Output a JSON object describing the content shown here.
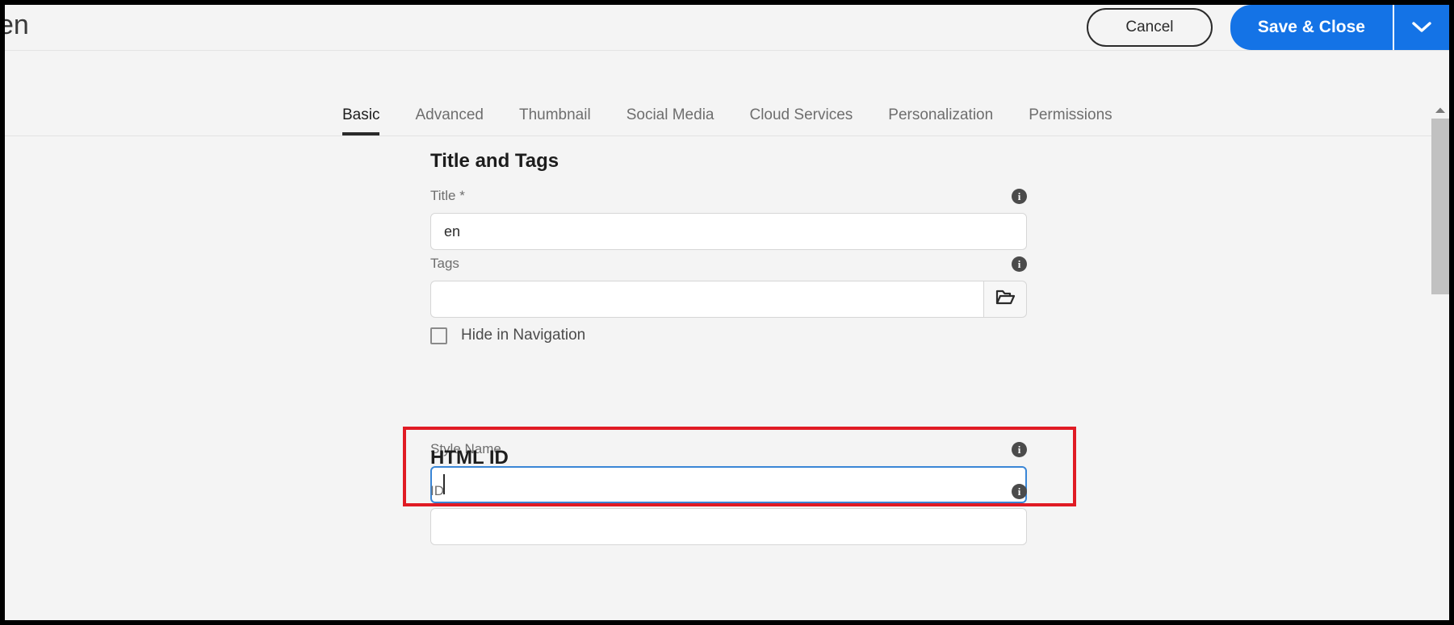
{
  "header": {
    "page_title": "en",
    "cancel_label": "Cancel",
    "save_label": "Save & Close",
    "save_caret_icon": "chevron-down-icon"
  },
  "tabs": [
    {
      "label": "Basic",
      "active": true
    },
    {
      "label": "Advanced",
      "active": false
    },
    {
      "label": "Thumbnail",
      "active": false
    },
    {
      "label": "Social Media",
      "active": false
    },
    {
      "label": "Cloud Services",
      "active": false
    },
    {
      "label": "Personalization",
      "active": false
    },
    {
      "label": "Permissions",
      "active": false
    }
  ],
  "sections": {
    "title_and_tags": {
      "heading": "Title and Tags",
      "title_field": {
        "label": "Title *",
        "value": "en",
        "info_icon": "info-icon"
      },
      "tags_field": {
        "label": "Tags",
        "value": "",
        "placeholder": "",
        "info_icon": "info-icon",
        "browse_icon": "folder-open-icon"
      },
      "hide_in_navigation": {
        "label": "Hide in Navigation",
        "checked": false
      },
      "style_name_field": {
        "label": "Style Name",
        "value": "",
        "placeholder": "",
        "info_icon": "info-icon",
        "focused": true,
        "highlight_color": "#e01b24"
      }
    },
    "html_id": {
      "heading": "HTML ID",
      "id_field": {
        "label": "ID",
        "value": "",
        "placeholder": "",
        "info_icon": "info-icon"
      }
    }
  },
  "scrollbar": {
    "up_arrow_icon": "caret-up-icon"
  },
  "colors": {
    "accent": "#1473e6",
    "focus_border": "#3a86d6",
    "highlight": "#e01b24",
    "page_bg": "#f4f4f4"
  },
  "info_glyph": "i"
}
